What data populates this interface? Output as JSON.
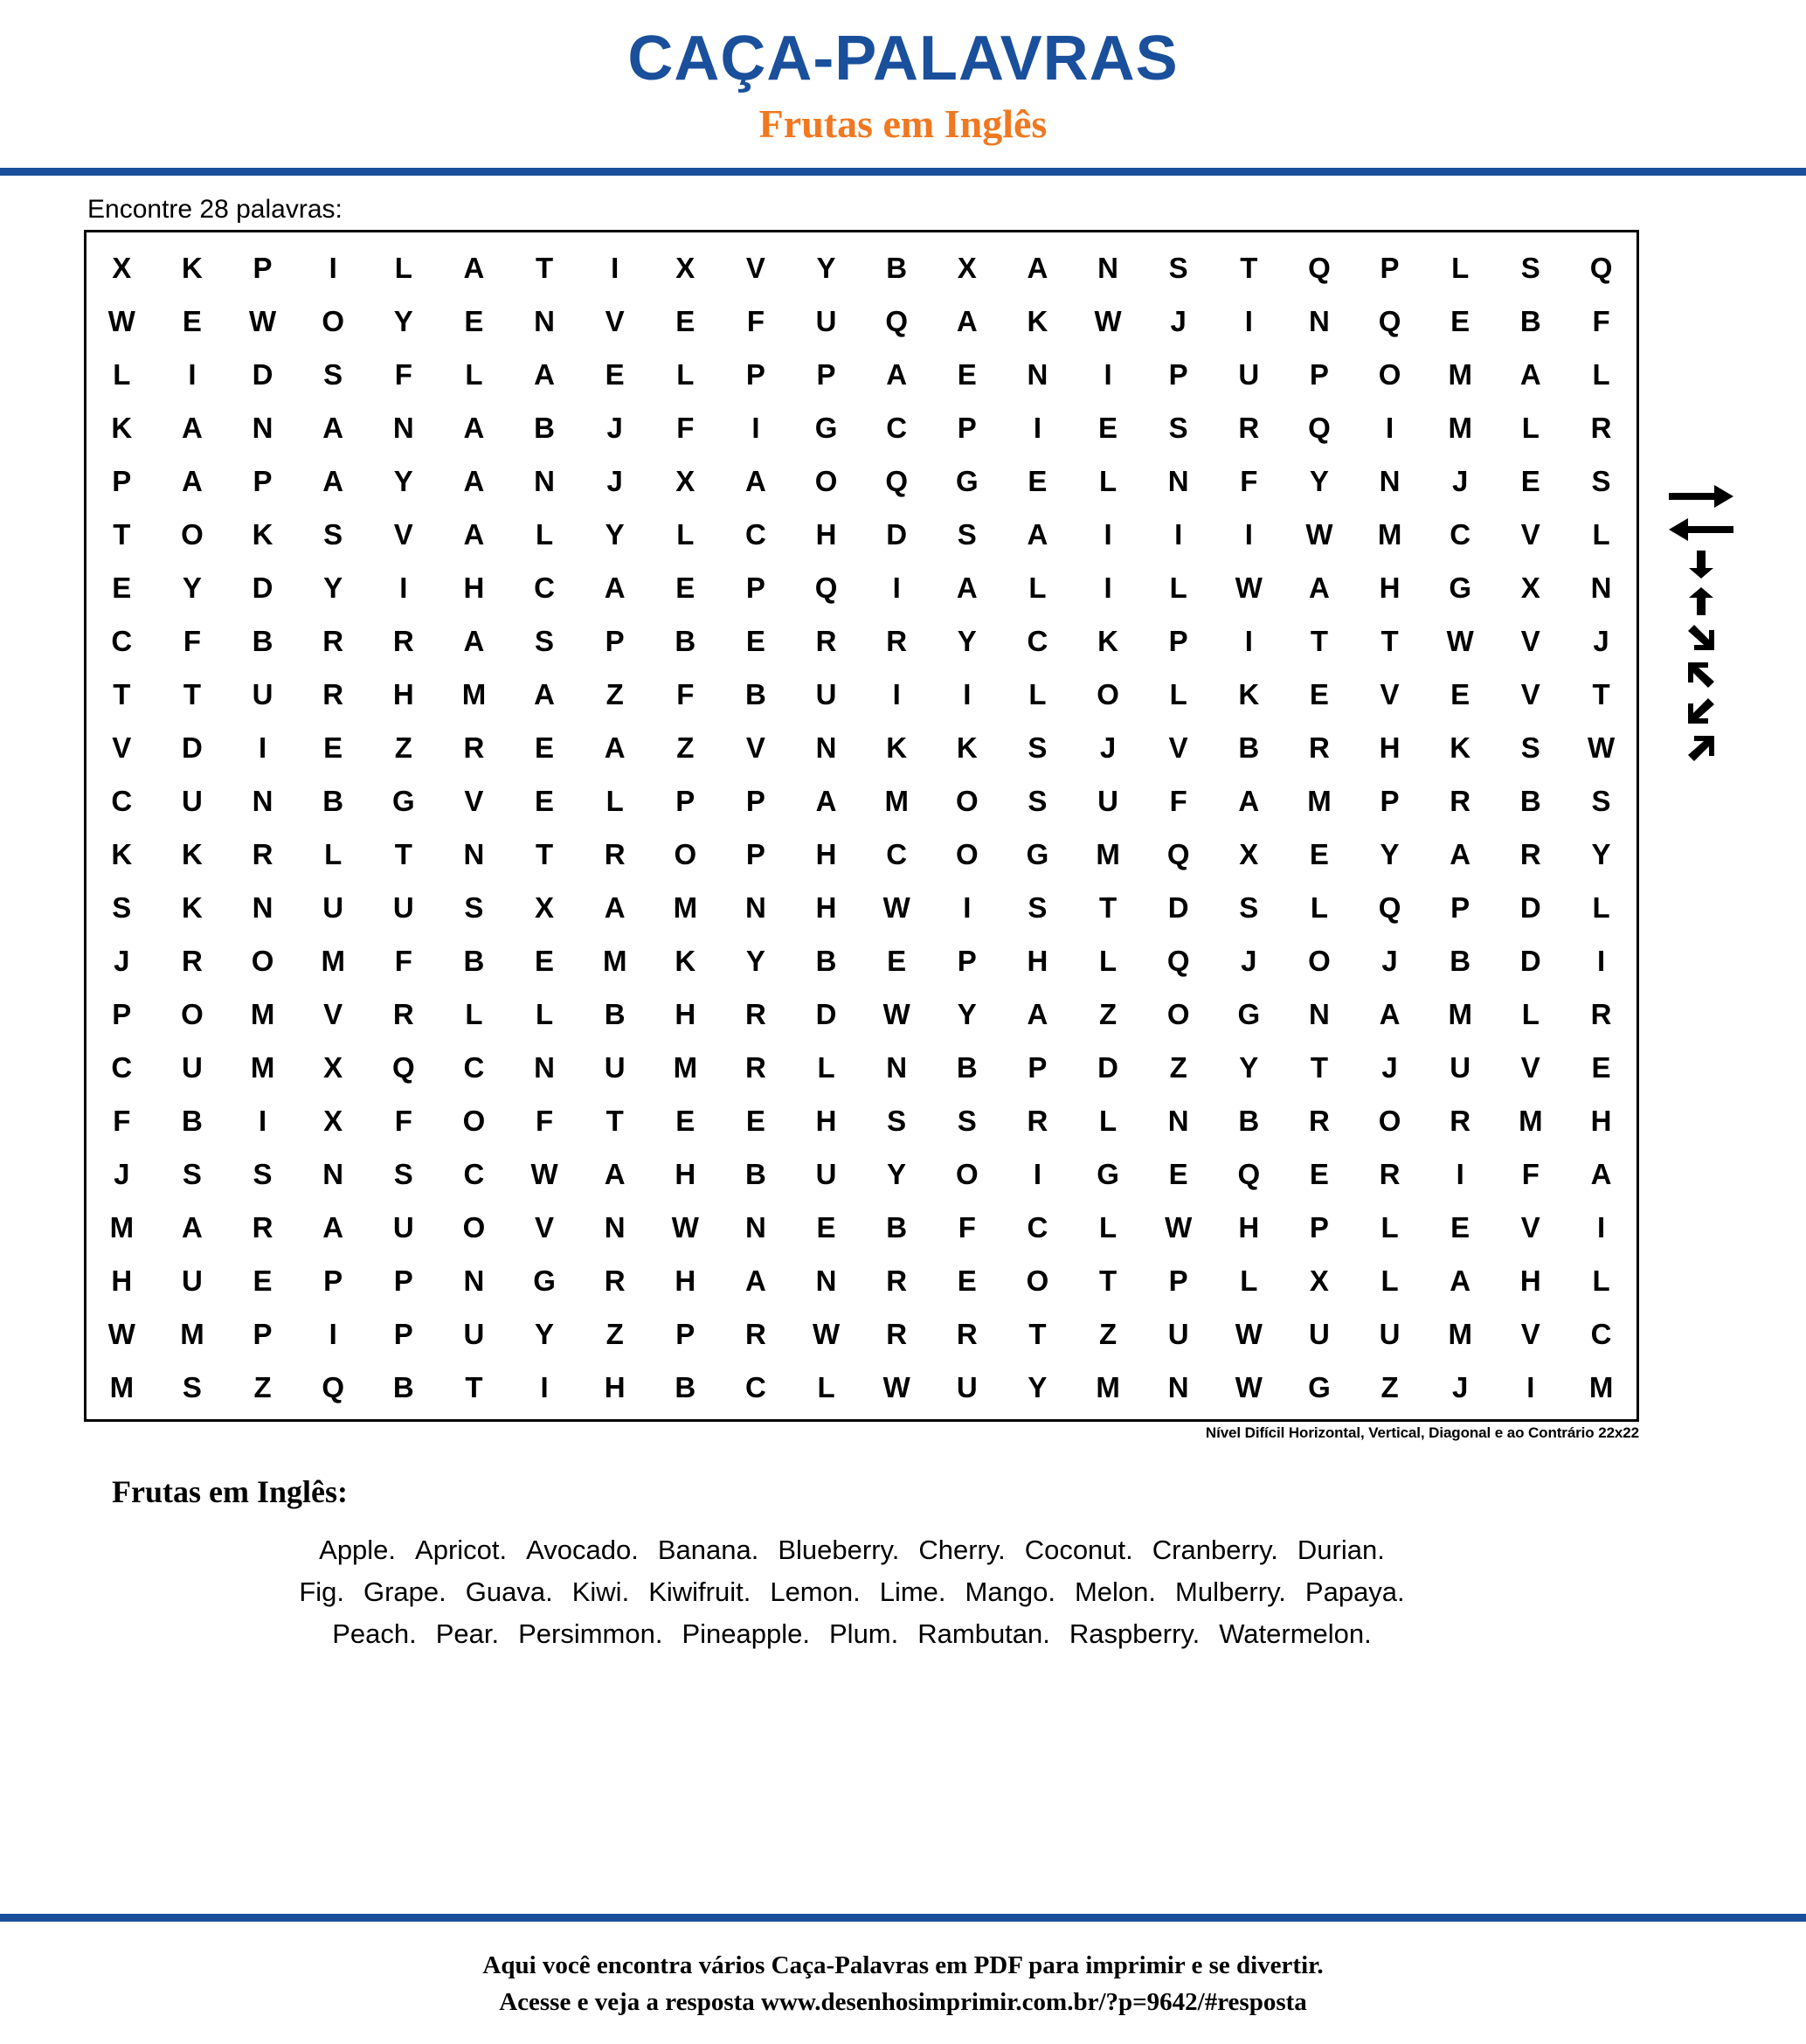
{
  "header": {
    "title": "CAÇA-PALAVRAS",
    "subtitle": "Frutas em Inglês"
  },
  "instruction": "Encontre 28 palavras:",
  "grid": {
    "rows": 22,
    "cols": 22,
    "note": "Nível Difícil Horizontal, Vertical, Diagonal e ao Contrário 22x22",
    "letters": [
      [
        "X",
        "K",
        "P",
        "I",
        "L",
        "A",
        "T",
        "I",
        "X",
        "V",
        "Y",
        "B",
        "X",
        "A",
        "N",
        "S",
        "T",
        "Q",
        "P",
        "L",
        "S",
        "Q"
      ],
      [
        "W",
        "E",
        "W",
        "O",
        "Y",
        "E",
        "N",
        "V",
        "E",
        "F",
        "U",
        "Q",
        "A",
        "K",
        "W",
        "J",
        "I",
        "N",
        "Q",
        "E",
        "B",
        "F"
      ],
      [
        "L",
        "I",
        "D",
        "S",
        "F",
        "L",
        "A",
        "E",
        "L",
        "P",
        "P",
        "A",
        "E",
        "N",
        "I",
        "P",
        "U",
        "P",
        "O",
        "M",
        "A",
        "L"
      ],
      [
        "K",
        "A",
        "N",
        "A",
        "N",
        "A",
        "B",
        "J",
        "F",
        "I",
        "G",
        "C",
        "P",
        "I",
        "E",
        "S",
        "R",
        "Q",
        "I",
        "M",
        "L",
        "R"
      ],
      [
        "P",
        "A",
        "P",
        "A",
        "Y",
        "A",
        "N",
        "J",
        "X",
        "A",
        "O",
        "Q",
        "G",
        "E",
        "L",
        "N",
        "F",
        "Y",
        "N",
        "J",
        "E",
        "S"
      ],
      [
        "T",
        "O",
        "K",
        "S",
        "V",
        "A",
        "L",
        "Y",
        "L",
        "C",
        "H",
        "D",
        "S",
        "A",
        "I",
        "I",
        "I",
        "W",
        "M",
        "C",
        "V",
        "L"
      ],
      [
        "E",
        "Y",
        "D",
        "Y",
        "I",
        "H",
        "C",
        "A",
        "E",
        "P",
        "Q",
        "I",
        "A",
        "L",
        "I",
        "L",
        "W",
        "A",
        "H",
        "G",
        "X",
        "N"
      ],
      [
        "C",
        "F",
        "B",
        "R",
        "R",
        "A",
        "S",
        "P",
        "B",
        "E",
        "R",
        "R",
        "Y",
        "C",
        "K",
        "P",
        "I",
        "T",
        "T",
        "W",
        "V",
        "J"
      ],
      [
        "T",
        "T",
        "U",
        "R",
        "H",
        "M",
        "A",
        "Z",
        "F",
        "B",
        "U",
        "I",
        "I",
        "L",
        "O",
        "L",
        "K",
        "E",
        "V",
        "E",
        "V",
        "T"
      ],
      [
        "V",
        "D",
        "I",
        "E",
        "Z",
        "R",
        "E",
        "A",
        "Z",
        "V",
        "N",
        "K",
        "K",
        "S",
        "J",
        "V",
        "B",
        "R",
        "H",
        "K",
        "S",
        "W"
      ],
      [
        "C",
        "U",
        "N",
        "B",
        "G",
        "V",
        "E",
        "L",
        "P",
        "P",
        "A",
        "M",
        "O",
        "S",
        "U",
        "F",
        "A",
        "M",
        "P",
        "R",
        "B",
        "S"
      ],
      [
        "K",
        "K",
        "R",
        "L",
        "T",
        "N",
        "T",
        "R",
        "O",
        "P",
        "H",
        "C",
        "O",
        "G",
        "M",
        "Q",
        "X",
        "E",
        "Y",
        "A",
        "R",
        "Y"
      ],
      [
        "S",
        "K",
        "N",
        "U",
        "U",
        "S",
        "X",
        "A",
        "M",
        "N",
        "H",
        "W",
        "I",
        "S",
        "T",
        "D",
        "S",
        "L",
        "Q",
        "P",
        "D",
        "L"
      ],
      [
        "J",
        "R",
        "O",
        "M",
        "F",
        "B",
        "E",
        "M",
        "K",
        "Y",
        "B",
        "E",
        "P",
        "H",
        "L",
        "Q",
        "J",
        "O",
        "J",
        "B",
        "D",
        "I"
      ],
      [
        "P",
        "O",
        "M",
        "V",
        "R",
        "L",
        "L",
        "B",
        "H",
        "R",
        "D",
        "W",
        "Y",
        "A",
        "Z",
        "O",
        "G",
        "N",
        "A",
        "M",
        "L",
        "R"
      ],
      [
        "C",
        "U",
        "M",
        "X",
        "Q",
        "C",
        "N",
        "U",
        "M",
        "R",
        "L",
        "N",
        "B",
        "P",
        "D",
        "Z",
        "Y",
        "T",
        "J",
        "U",
        "V",
        "E"
      ],
      [
        "F",
        "B",
        "I",
        "X",
        "F",
        "O",
        "F",
        "T",
        "E",
        "E",
        "H",
        "S",
        "S",
        "R",
        "L",
        "N",
        "B",
        "R",
        "O",
        "R",
        "M",
        "H"
      ],
      [
        "J",
        "S",
        "S",
        "N",
        "S",
        "C",
        "W",
        "A",
        "H",
        "B",
        "U",
        "Y",
        "O",
        "I",
        "G",
        "E",
        "Q",
        "E",
        "R",
        "I",
        "F",
        "A"
      ],
      [
        "M",
        "A",
        "R",
        "A",
        "U",
        "O",
        "V",
        "N",
        "W",
        "N",
        "E",
        "B",
        "F",
        "C",
        "L",
        "W",
        "H",
        "P",
        "L",
        "E",
        "V",
        "I"
      ],
      [
        "H",
        "U",
        "E",
        "P",
        "P",
        "N",
        "G",
        "R",
        "H",
        "A",
        "N",
        "R",
        "E",
        "O",
        "T",
        "P",
        "L",
        "X",
        "L",
        "A",
        "H",
        "L"
      ],
      [
        "W",
        "M",
        "P",
        "I",
        "P",
        "U",
        "Y",
        "Z",
        "P",
        "R",
        "W",
        "R",
        "R",
        "T",
        "Z",
        "U",
        "W",
        "U",
        "U",
        "M",
        "V",
        "C"
      ],
      [
        "M",
        "S",
        "Z",
        "Q",
        "B",
        "T",
        "I",
        "H",
        "B",
        "C",
        "L",
        "W",
        "U",
        "Y",
        "M",
        "N",
        "W",
        "G",
        "Z",
        "J",
        "I",
        "M"
      ]
    ]
  },
  "legend": {
    "directions": [
      "arrow-right",
      "arrow-left",
      "arrow-down",
      "arrow-up",
      "arrow-down-right",
      "arrow-up-left",
      "arrow-down-left",
      "arrow-up-right"
    ]
  },
  "word_list": {
    "title": "Frutas em Inglês:",
    "rows": [
      [
        "Apple.",
        "Apricot.",
        "Avocado.",
        "Banana.",
        "Blueberry.",
        "Cherry.",
        "Coconut.",
        "Cranberry.",
        "Durian."
      ],
      [
        "Fig.",
        "Grape.",
        "Guava.",
        "Kiwi.",
        "Kiwifruit.",
        "Lemon.",
        "Lime.",
        "Mango.",
        "Melon.",
        "Mulberry.",
        "Papaya."
      ],
      [
        "Peach.",
        "Pear.",
        "Persimmon.",
        "Pineapple.",
        "Plum.",
        "Rambutan.",
        "Raspberry.",
        "Watermelon."
      ]
    ]
  },
  "footer": {
    "line1": "Aqui você encontra vários Caça-Palavras em PDF para imprimir e se divertir.",
    "line2": "Acesse e veja a resposta  www.desenhosimprimir.com.br/?p=9642/#resposta"
  },
  "colors": {
    "title_blue": "#1a4f9c",
    "subtitle_orange": "#f07820",
    "text_black": "#000000"
  }
}
